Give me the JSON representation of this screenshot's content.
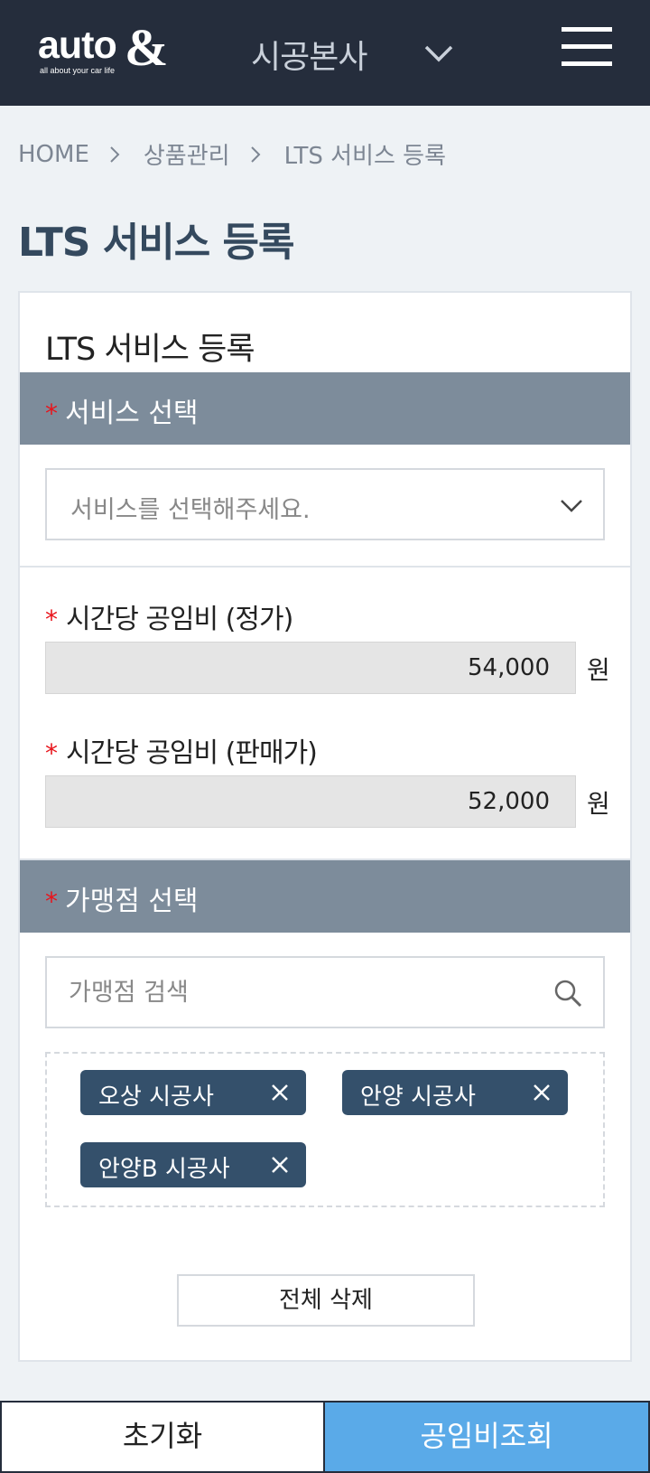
{
  "header": {
    "logo_text": "auto",
    "logo_mark": "&",
    "logo_tagline": "all about your car life",
    "branch_name": "시공본사",
    "branch_caret_icon": "chevron-down-icon",
    "menu_icon": "hamburger-menu-icon"
  },
  "breadcrumb": {
    "items": [
      "HOME",
      "상품관리",
      "LTS 서비스 등록"
    ],
    "separator_icon": "chevron-right-icon"
  },
  "page_title": "LTS 서비스 등록",
  "card": {
    "title": "LTS 서비스 등록",
    "required_mark": "*",
    "service_section": {
      "label": "서비스 선택",
      "select_placeholder": "서비스를 선택해주세요."
    },
    "labor_regular": {
      "label": "시간당 공임비 (정가)",
      "value": "54,000",
      "unit": "원"
    },
    "labor_sale": {
      "label": "시간당 공임비 (판매가)",
      "value": "52,000",
      "unit": "원"
    },
    "store_section": {
      "label": "가맹점 선택",
      "search_placeholder": "가맹점 검색",
      "search_icon": "search-icon"
    },
    "selected_stores": [
      "오상 시공사",
      "안양 시공사",
      "안양B 시공사"
    ],
    "clear_all_label": "전체 삭제"
  },
  "footer": {
    "reset_label": "초기화",
    "query_label": "공임비조회"
  },
  "colors": {
    "topbar": "#252d3c",
    "section_header": "#7d8c9b",
    "chip": "#34506b",
    "required": "#e8141c",
    "primary_button": "#5aaae8",
    "page_title": "#34495e"
  }
}
